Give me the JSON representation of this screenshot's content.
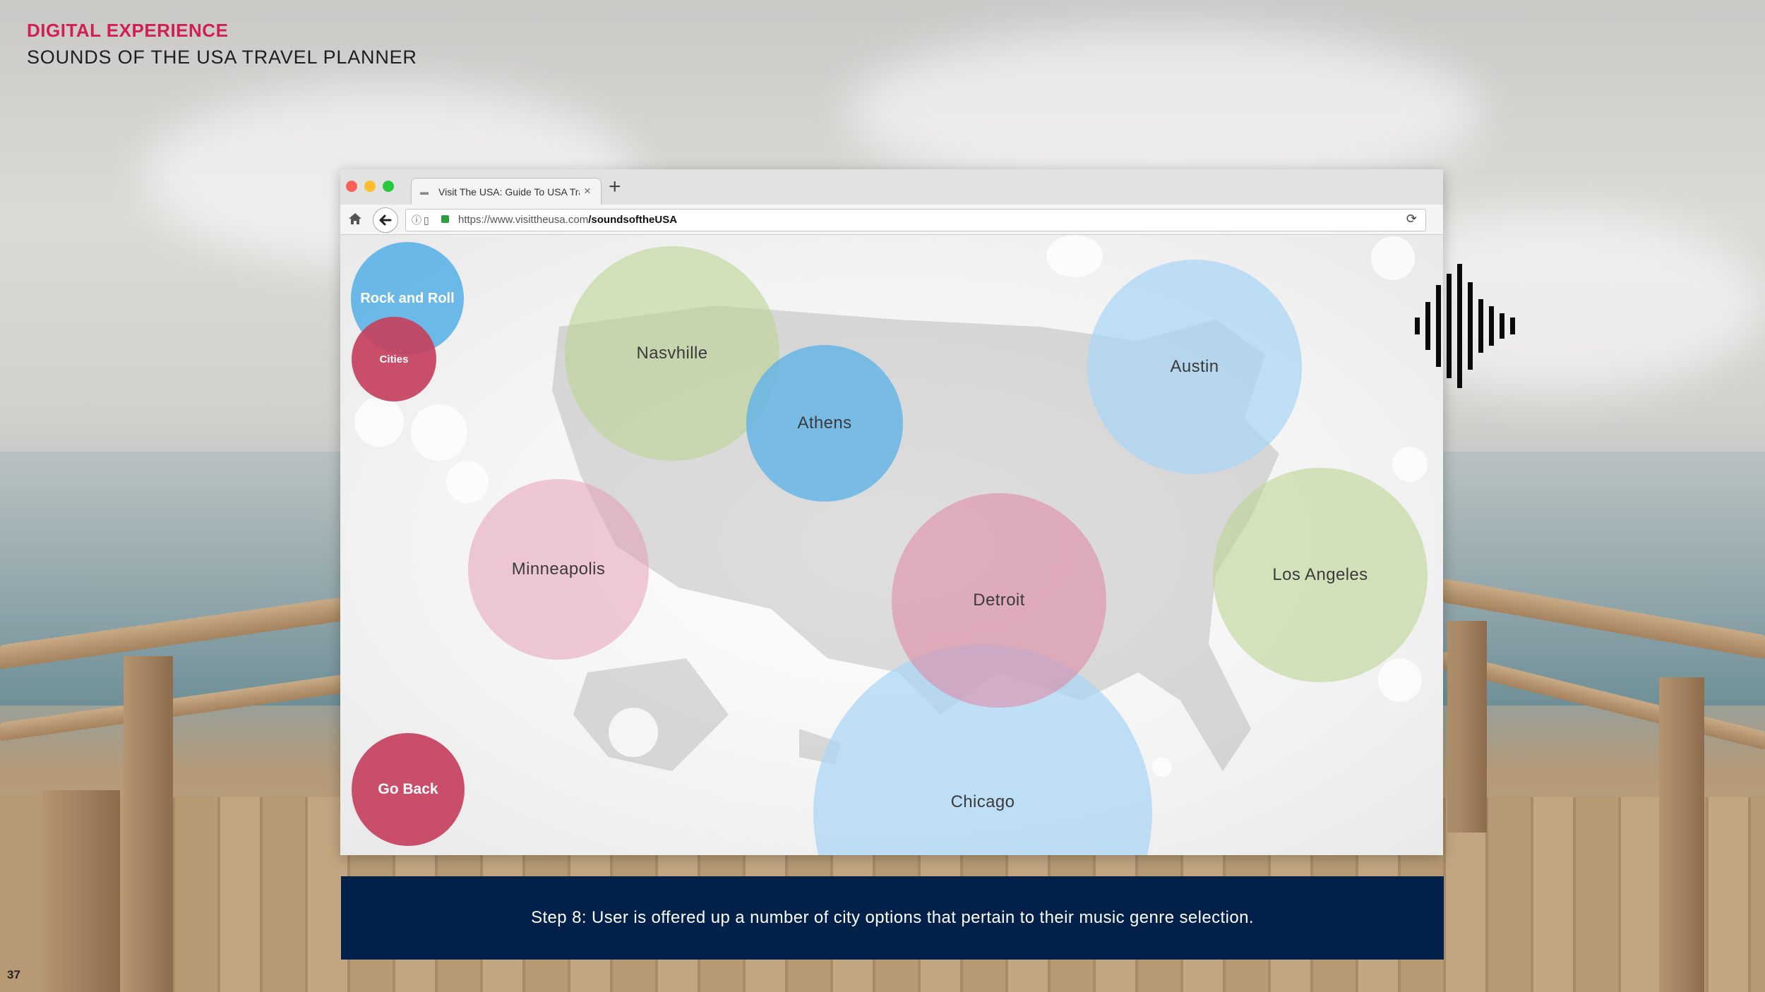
{
  "slide": {
    "section_title": "DIGITAL EXPERIENCE",
    "subtitle": "SOUNDS OF THE USA TRAVEL PLANNER",
    "page_number": "37",
    "caption": "Step 8: User is offered up a number of city options that pertain to their music genre selection."
  },
  "browser": {
    "tab_title": "Visit The USA: Guide To USA Tra",
    "tab_close": "×",
    "new_tab": "+",
    "url_base": "https://www.visittheusa.com",
    "url_path": "/soundsoftheUSA",
    "reload_icon": "⟳",
    "dots": [
      "#fc5f57",
      "#fdbd2e",
      "#28c840"
    ]
  },
  "controls": {
    "genre": "Rock and Roll",
    "category": "Cities",
    "go_back": "Go Back"
  },
  "cities": [
    "Nasvhille",
    "Athens",
    "Austin",
    "Minneapolis",
    "Detroit",
    "Los Angeles",
    "Chicago"
  ],
  "colors": {
    "accent": "#d21f52",
    "control_red": "#c5405e",
    "control_blue": "#5cb2e8",
    "caption_bg": "#02214a"
  }
}
